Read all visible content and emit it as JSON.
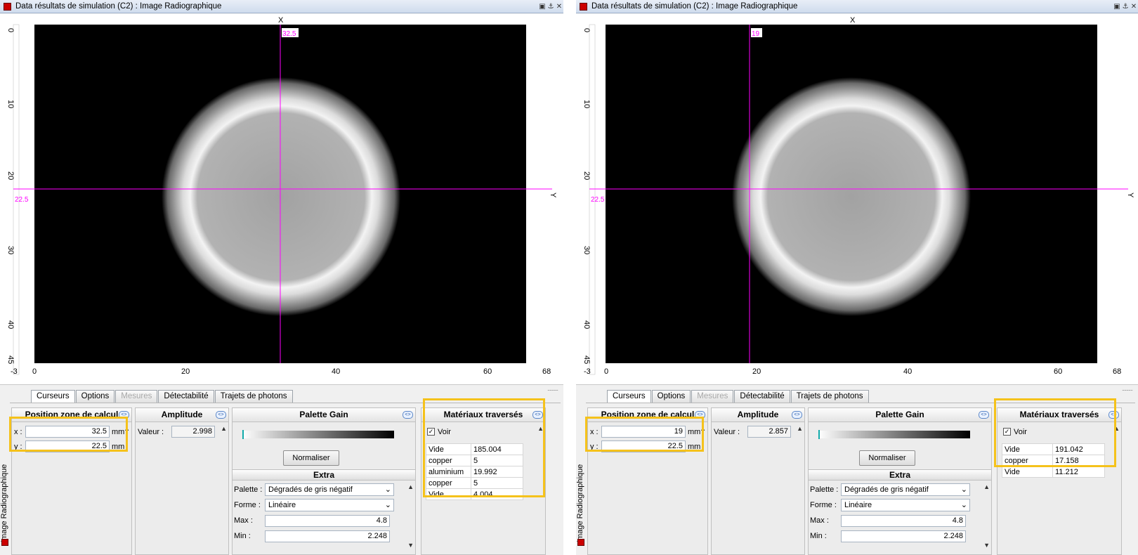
{
  "colors": {
    "highlight": "#f5c21b",
    "cursor": "#ff00ff",
    "window_icon": "#cc0000"
  },
  "windows": [
    {
      "title": "Data résultats de simulation (C2) : Image Radiographique",
      "side_label": "Image Radiographique",
      "viewer": {
        "x_axis_label": "X",
        "y_axis_label": "Y",
        "x_ticks": [
          "-3",
          "0",
          "20",
          "40",
          "60",
          "68"
        ],
        "y_ticks": [
          "0",
          "10",
          "20",
          "30",
          "40",
          "45"
        ],
        "cursor_x_label": "32.5",
        "cursor_y_label": "22.5",
        "cursor_x_value": 32.5,
        "cursor_y_value": 22.5
      },
      "tabs": [
        "Curseurs",
        "Options",
        "Mesures",
        "Détectabilité",
        "Trajets de photons"
      ],
      "position": {
        "header": "Position zone de calcul",
        "x_label": "x :",
        "x_value": "32.5",
        "y_label": "y :",
        "y_value": "22.5",
        "unit": "mm"
      },
      "amplitude": {
        "header": "Amplitude",
        "label": "Valeur :",
        "value": "2.998"
      },
      "palette": {
        "header": "Palette Gain",
        "normalize_label": "Normaliser",
        "extra_header": "Extra",
        "palette_label": "Palette :",
        "palette_value": "Dégradés de gris négatif",
        "forme_label": "Forme :",
        "forme_value": "Linéaire",
        "max_label": "Max :",
        "max_value": "4.8",
        "min_label": "Min :",
        "min_value": "2.248"
      },
      "materials": {
        "header": "Matériaux traversés",
        "voir_label": "Voir",
        "rows": [
          {
            "name": "Vide",
            "value": "185.004"
          },
          {
            "name": "copper",
            "value": "5"
          },
          {
            "name": "aluminium",
            "value": "19.992"
          },
          {
            "name": "copper",
            "value": "5"
          },
          {
            "name": "Vide",
            "value": "4.004"
          }
        ]
      }
    },
    {
      "title": "Data résultats de simulation (C2) : Image Radiographique",
      "side_label": "Image Radiographique",
      "viewer": {
        "x_axis_label": "X",
        "y_axis_label": "Y",
        "x_ticks": [
          "-3",
          "0",
          "20",
          "40",
          "60",
          "68"
        ],
        "y_ticks": [
          "0",
          "10",
          "20",
          "30",
          "40",
          "45"
        ],
        "cursor_x_label": "19",
        "cursor_y_label": "22.5",
        "cursor_x_value": 19,
        "cursor_y_value": 22.5
      },
      "tabs": [
        "Curseurs",
        "Options",
        "Mesures",
        "Détectabilité",
        "Trajets de photons"
      ],
      "position": {
        "header": "Position zone de calcul",
        "x_label": "x :",
        "x_value": "19",
        "y_label": "y :",
        "y_value": "22.5",
        "unit": "mm"
      },
      "amplitude": {
        "header": "Amplitude",
        "label": "Valeur :",
        "value": "2.857"
      },
      "palette": {
        "header": "Palette Gain",
        "normalize_label": "Normaliser",
        "extra_header": "Extra",
        "palette_label": "Palette :",
        "palette_value": "Dégradés de gris négatif",
        "forme_label": "Forme :",
        "forme_value": "Linéaire",
        "max_label": "Max :",
        "max_value": "4.8",
        "min_label": "Min :",
        "min_value": "2.248"
      },
      "materials": {
        "header": "Matériaux traversés",
        "voir_label": "Voir",
        "rows": [
          {
            "name": "Vide",
            "value": "191.042"
          },
          {
            "name": "copper",
            "value": "17.158"
          },
          {
            "name": "Vide",
            "value": "11.212"
          }
        ]
      }
    }
  ]
}
